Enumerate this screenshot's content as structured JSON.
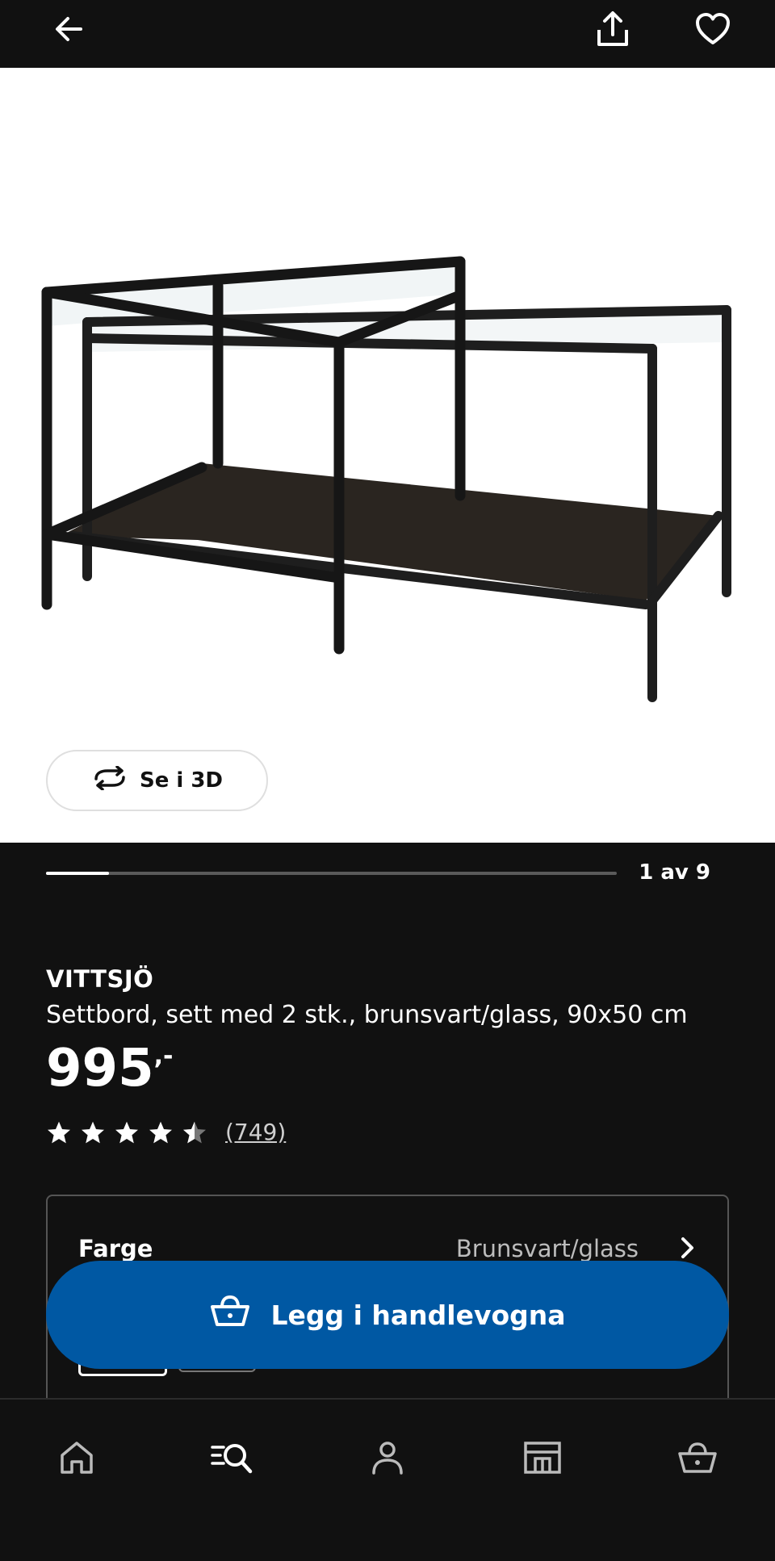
{
  "header": {
    "back_icon": "arrow-left-icon",
    "share_icon": "share-icon",
    "favorite_icon": "heart-icon"
  },
  "gallery": {
    "view_3d_label": "Se i 3D",
    "pager_text": "1 av 9",
    "progress_fraction": 0.11
  },
  "product": {
    "name": "VITTSJÖ",
    "description": "Settbord, sett med 2 stk., brunsvart/glass, 90x50 cm",
    "price": "995",
    "price_suffix": ",-",
    "rating_stars": 4.5,
    "review_count": "(749)"
  },
  "options": {
    "color_label": "Farge",
    "color_value": "Brunsvart/glass"
  },
  "actions": {
    "add_to_cart_label": "Legg i handlevogna"
  },
  "bottom_nav": {
    "items": [
      "home-icon",
      "search-icon",
      "profile-icon",
      "store-icon",
      "cart-icon"
    ]
  },
  "colors": {
    "background": "#111111",
    "accent": "#0058a3"
  }
}
